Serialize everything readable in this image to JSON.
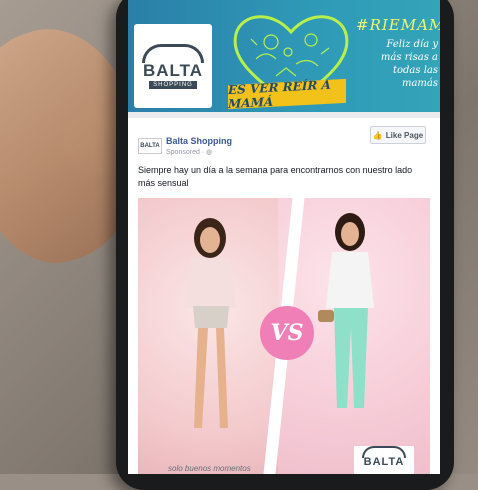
{
  "banner": {
    "brand_name": "BALTA",
    "brand_sub": "SHOPPING",
    "ribbon_text": "ES VER REÍR A MAMÁ",
    "hashtag": "#RIEMAMA",
    "tagline": "Feliz día y más risas a todas las mamás"
  },
  "post": {
    "page_name": "Balta Shopping",
    "sponsored": "Sponsored · ",
    "like_button": "Like Page",
    "text": "Siempre hay un día a la semana para encontrarnos con nuestro lado más sensual",
    "vs_label": "VS",
    "footer_text": "solo buenos momentos",
    "image_logo": "BALTA"
  },
  "colors": {
    "banner": "#2f9ab8",
    "ribbon": "#f2c21b",
    "vs_circle": "#ef7fb6",
    "link": "#3b5998"
  }
}
